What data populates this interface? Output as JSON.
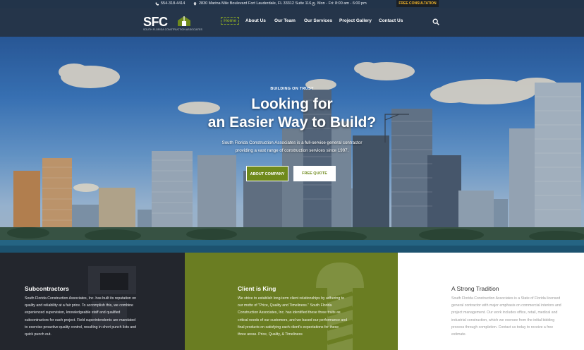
{
  "topbar": {
    "phone": "554-318-4414",
    "address": "2830 Marina Mile Boulevard Fort Lauderdale, FL 33312 Suite 116",
    "hours": "Mon - Fri: 8:00 am - 6:00 pm",
    "cta": "FREE CONSULTATION"
  },
  "header": {
    "logo_text": "SFC",
    "logo_tagline": "SOUTH FLORIDA CONSTRUCTION ASSOCIATES",
    "nav": [
      "Home",
      "About Us",
      "Our Team",
      "Our Services",
      "Project Gallery",
      "Contact Us"
    ]
  },
  "hero": {
    "eyebrow": "BUILDING ON TRUST",
    "title_line1": "Looking for",
    "title_line2": "an Easier Way to Build?",
    "sub_line1": "South Florida Construction Associates is a full-service general contractor",
    "sub_line2": "providing a vast range of construction services since 1997.",
    "button_primary": "ABOUT COMPANY",
    "button_secondary": "FREE QUOTE"
  },
  "features": [
    {
      "title": "Subcontractors",
      "body": "South Florida Construction Associates, Inc. has built its reputation on quality and reliability at a fair price. To accomplish this, we combine experienced supervision, knowledgeable staff and qualified subcontractors for each project. Field superintendents are mandated to exercise proactive quality control, resulting in short punch lists and quick punch out."
    },
    {
      "title": "Client is King",
      "body": "We strive to establish long-term client relationships by adhering to our motto of \"Price, Quality and Timeliness.\" South Florida Construction Associates, Inc. has identified these three traits as critical needs of our customers, and we based our performance and final products on satisfying each client's expectations for these three areas. Price, Quality, & Timeliness"
    },
    {
      "title": "A Strong Tradition",
      "body": "South Florida Construction Associates is a State of Florida licensed general contractor with major emphasis on commercial interiors and project management. Our work includes office, retail, medical and industrial construction, which we oversee from the initial bidding process through completion. Contact us today to receive a free estimate."
    }
  ],
  "colors": {
    "accent_green": "#6f8a1c",
    "header_bg": "#25354a",
    "cta_text": "#f2b52b"
  }
}
